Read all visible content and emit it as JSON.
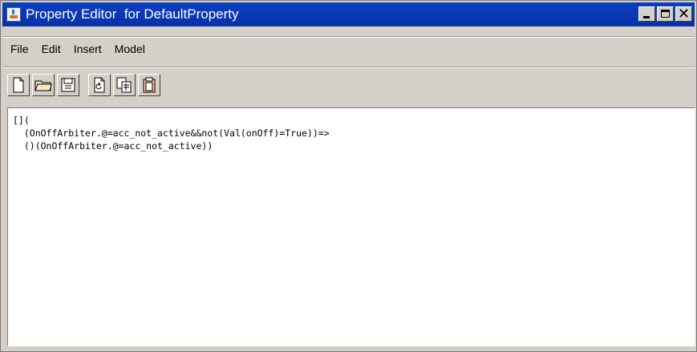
{
  "window": {
    "title": "Property Editor  for DefaultProperty",
    "minimize_label": "_",
    "close_label": "✕"
  },
  "menu": {
    "items": [
      {
        "label": "File"
      },
      {
        "label": "Edit"
      },
      {
        "label": "Insert"
      },
      {
        "label": "Model"
      }
    ]
  },
  "toolbar": {
    "buttons": [
      {
        "icon": "new-file-icon"
      },
      {
        "icon": "open-folder-icon"
      },
      {
        "icon": "save-icon"
      },
      {
        "icon": "refresh-document-icon"
      },
      {
        "icon": "copy-document-icon"
      },
      {
        "icon": "clipboard-icon"
      }
    ]
  },
  "editor": {
    "lines": [
      "[](",
      "  (OnOffArbiter.@=acc_not_active&&not(Val(onOff)=True))=>",
      "  ()(OnOffArbiter.@=acc_not_active))"
    ]
  }
}
